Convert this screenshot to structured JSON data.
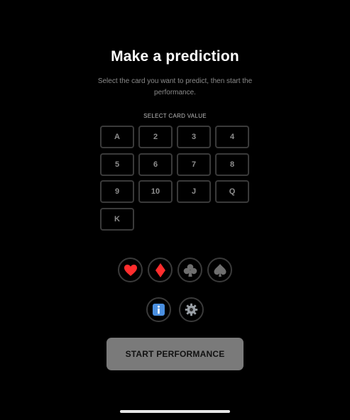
{
  "header": {
    "title": "Make a prediction",
    "subtitle": "Select the card you want to predict, then start the performance."
  },
  "value_section": {
    "label": "SELECT CARD VALUE",
    "values": [
      "A",
      "2",
      "3",
      "4",
      "5",
      "6",
      "7",
      "8",
      "9",
      "10",
      "J",
      "Q",
      "K"
    ]
  },
  "suits": [
    {
      "name": "hearts",
      "icon": "heart-icon",
      "color": "#ff2d2d"
    },
    {
      "name": "diamonds",
      "icon": "diamond-icon",
      "color": "#ff2d2d"
    },
    {
      "name": "clubs",
      "icon": "club-icon",
      "color": "#6f6f6f"
    },
    {
      "name": "spades",
      "icon": "spade-icon",
      "color": "#6f6f6f"
    }
  ],
  "tools": [
    {
      "name": "info",
      "icon": "info-icon",
      "color": "#4a8fe0"
    },
    {
      "name": "settings",
      "icon": "gear-icon",
      "color": "#9aa0a6"
    }
  ],
  "actions": {
    "start_label": "START PERFORMANCE"
  },
  "theme": {
    "background": "#000000",
    "button_border": "#3a3a3a",
    "start_button_bg": "#7a7a7a"
  }
}
